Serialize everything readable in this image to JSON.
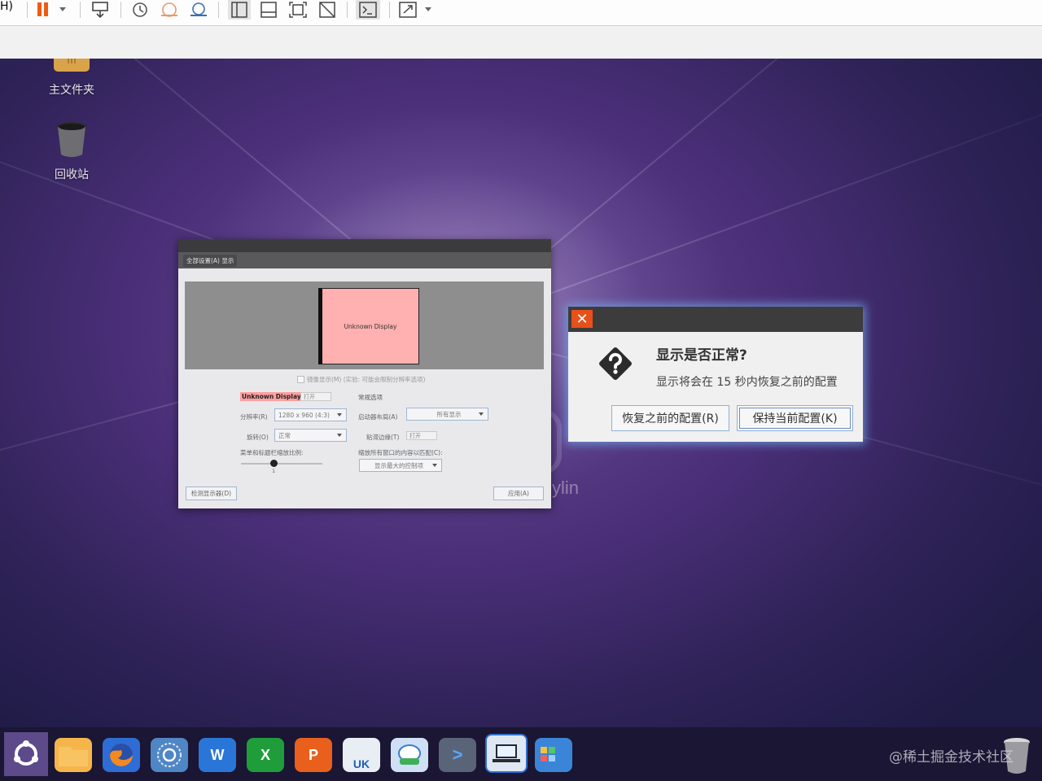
{
  "vm_toolbar": {
    "menu_fragment": "H)",
    "buttons": [
      {
        "name": "pause-icon"
      },
      {
        "name": "send-keys-icon"
      },
      {
        "name": "snapshot-icon"
      },
      {
        "name": "revert-snapshot-icon"
      },
      {
        "name": "snapshot-manager-icon"
      },
      {
        "name": "library-view-icon"
      },
      {
        "name": "thumbnail-bar-icon"
      },
      {
        "name": "fit-guest-icon"
      },
      {
        "name": "unity-icon"
      },
      {
        "name": "console-view-icon"
      },
      {
        "name": "fullscreen-icon"
      }
    ]
  },
  "desktop": {
    "icons": [
      {
        "label": "主文件夹"
      },
      {
        "label": "回收站"
      }
    ],
    "brand_fragment": "ylin"
  },
  "settings_window": {
    "toolbar_label": "全部设置(A)  显示",
    "monitor_label": "Unknown Display",
    "mirror_label": "镜像显示(M) (实验: 可能会限制分辨率选项)",
    "display_name": "Unknown Display",
    "display_toggle": "打开",
    "general_options": "常规选项",
    "resolution_label": "分辨率(R)",
    "resolution_value": "1280 x 960 (4:3)",
    "launcher_label": "启动器布局(A)",
    "launcher_value": "所有显示",
    "rotation_label": "旋转(O)",
    "rotation_value": "正常",
    "sticky_label": "粘滞边缘(T)",
    "sticky_value": "打开",
    "scale_label": "菜单和标题栏缩放比例:",
    "scale_value": "1",
    "scale_all_label": "缩放所有窗口的内容以匹配(C):",
    "scale_all_value": "显示最大的控制项",
    "detect_button": "检测显示器(D)",
    "apply_button": "应用(A)"
  },
  "confirm_dialog": {
    "close_symbol": "✕",
    "title": "显示是否正常?",
    "message": "显示将会在 15 秒内恢复之前的配置",
    "revert_button": "恢复之前的配置(R)",
    "keep_button": "保持当前配置(K)"
  },
  "taskbar": {
    "apps": [
      {
        "name": "ubuntu-kylin-start",
        "glyph": "",
        "color": "#6b4f96"
      },
      {
        "name": "files",
        "glyph": "",
        "color": "#f6b54b"
      },
      {
        "name": "firefox",
        "glyph": "",
        "color": "#e8602a"
      },
      {
        "name": "browser",
        "glyph": "○",
        "color": "#4f86c6"
      },
      {
        "name": "wps-writer",
        "glyph": "W",
        "color": "#2a76d8"
      },
      {
        "name": "wps-spreadsheet",
        "glyph": "X",
        "color": "#1f9d3a"
      },
      {
        "name": "wps-presentation",
        "glyph": "P",
        "color": "#e8601c"
      },
      {
        "name": "software-center",
        "glyph": "UK",
        "color": "#e9eef5"
      },
      {
        "name": "kylin-assistant",
        "glyph": "",
        "color": "#cfe0f5"
      },
      {
        "name": "terminal",
        "glyph": ">",
        "color": "#5a6478"
      },
      {
        "name": "display-settings",
        "glyph": "",
        "color": "#dfe7f2"
      },
      {
        "name": "workspace-switcher",
        "glyph": "",
        "color": "#3a85d8"
      }
    ],
    "watermark": "@稀土掘金技术社区"
  }
}
